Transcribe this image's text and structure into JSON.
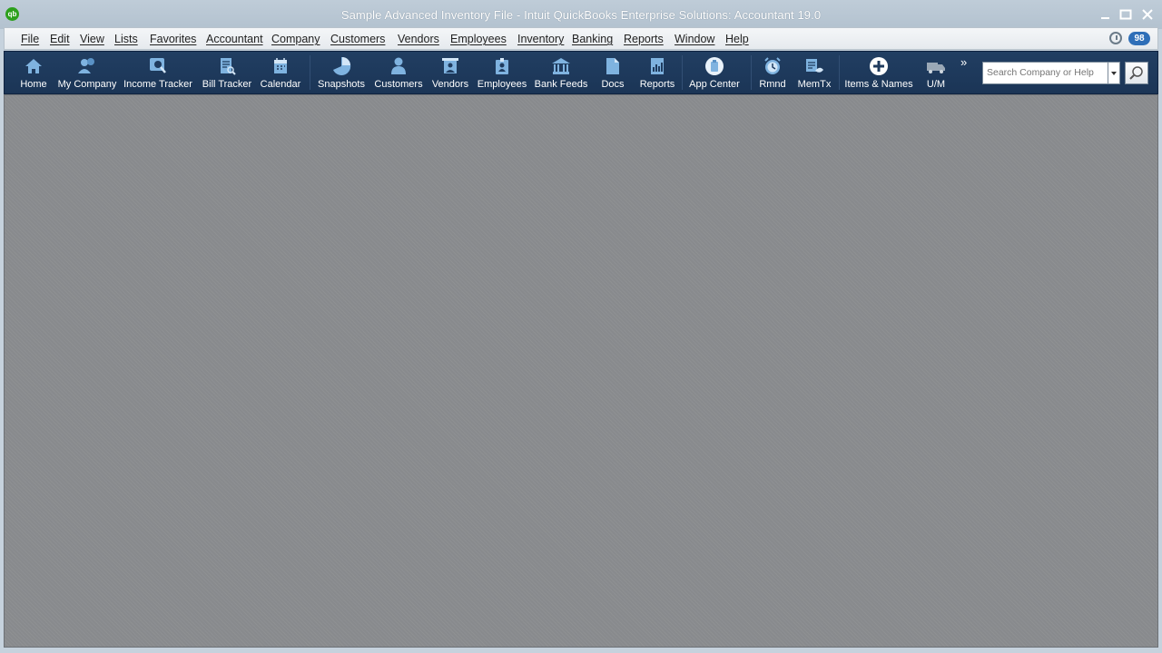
{
  "window": {
    "title": "Sample Advanced Inventory File  - Intuit QuickBooks Enterprise Solutions: Accountant 19.0",
    "logo_text": "qb"
  },
  "menu": {
    "items": [
      "File",
      "Edit",
      "View",
      "Lists",
      "Favorites",
      "Accountant",
      "Company",
      "Customers",
      "Vendors",
      "Employees",
      "Inventory",
      "Banking",
      "Reports",
      "Window",
      "Help"
    ],
    "alert_count": "98"
  },
  "toolbar": {
    "buttons": [
      {
        "label": "Home",
        "icon": "home-icon"
      },
      {
        "label": "My Company",
        "icon": "my-company-icon"
      },
      {
        "label": "Income Tracker",
        "icon": "income-tracker-icon"
      },
      {
        "label": "Bill Tracker",
        "icon": "bill-tracker-icon"
      },
      {
        "label": "Calendar",
        "icon": "calendar-icon"
      },
      {
        "label": "Snapshots",
        "icon": "pie-chart-icon"
      },
      {
        "label": "Customers",
        "icon": "customer-icon"
      },
      {
        "label": "Vendors",
        "icon": "vendor-icon"
      },
      {
        "label": "Employees",
        "icon": "employee-badge-icon"
      },
      {
        "label": "Bank Feeds",
        "icon": "bank-icon"
      },
      {
        "label": "Docs",
        "icon": "document-icon"
      },
      {
        "label": "Reports",
        "icon": "report-icon"
      },
      {
        "label": "App Center",
        "icon": "app-center-icon"
      },
      {
        "label": "Rmnd",
        "icon": "reminder-clock-icon"
      },
      {
        "label": "MemTx",
        "icon": "memorized-transactions-icon"
      },
      {
        "label": "Items & Names",
        "icon": "plus-circle-icon"
      },
      {
        "label": "U/M",
        "icon": "truck-icon"
      }
    ],
    "overflow_glyph": "»",
    "search_placeholder": "Search Company or Help"
  },
  "colors": {
    "toolbar_bg": "#1f3b5e",
    "workspace_bg": "#888a8d",
    "badge": "#2f6fb8"
  }
}
